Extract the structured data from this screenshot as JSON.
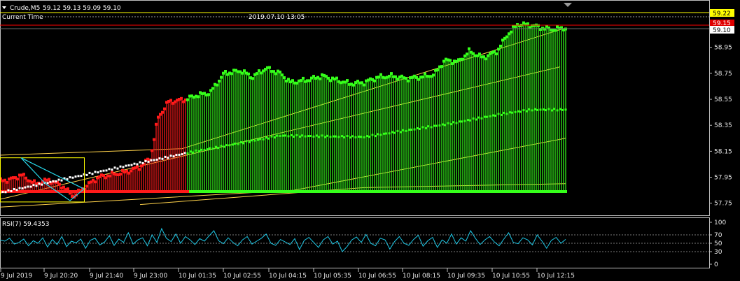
{
  "header": {
    "symbol": "Crude,M5",
    "ohlc": "59.12 59.13 59.09 59.10",
    "current_time_label": "Current Time",
    "current_time_value": "2019.07.10 13:05"
  },
  "price_markers": {
    "high_line": "59.22",
    "red_line": "59.15",
    "current": "59.10"
  },
  "colors": {
    "background": "#000000",
    "bull": "#35ff1a",
    "bear": "#ff1a1a",
    "rsi_line": "#1ec8e6",
    "level_line": "#ffff00",
    "channel_line": "#ffd24a",
    "pattern_line": "#27d6e8",
    "red_marker": "#ff0000",
    "current_marker": "#ffffff"
  },
  "chart_data": [
    {
      "type": "candlestick",
      "title": "Crude,M5",
      "y_ticks": [
        "59.10",
        "58.95",
        "58.75",
        "58.55",
        "58.35",
        "58.15",
        "57.95",
        "57.75"
      ],
      "ylim": [
        57.7,
        59.25
      ],
      "x_ticks": [
        "9 Jul 2019",
        "9 Jul 20:20",
        "9 Jul 21:40",
        "9 Jul 23:00",
        "10 Jul 01:35",
        "10 Jul 02:55",
        "10 Jul 04:15",
        "10 Jul 05:35",
        "10 Jul 06:55",
        "10 Jul 08:15",
        "10 Jul 09:35",
        "10 Jul 10:55",
        "10 Jul 12:15"
      ],
      "close_profile": [
        [
          0,
          57.92
        ],
        [
          20,
          57.94
        ],
        [
          30,
          57.97
        ],
        [
          50,
          57.9
        ],
        [
          70,
          57.93
        ],
        [
          90,
          57.88
        ],
        [
          105,
          57.8
        ],
        [
          118,
          57.86
        ],
        [
          140,
          57.95
        ],
        [
          160,
          57.97
        ],
        [
          180,
          57.99
        ],
        [
          200,
          58.03
        ],
        [
          215,
          58.1
        ],
        [
          225,
          58.4
        ],
        [
          240,
          58.53
        ],
        [
          266,
          58.55
        ],
        [
          280,
          58.58
        ],
        [
          300,
          58.6
        ],
        [
          320,
          58.75
        ],
        [
          345,
          58.77
        ],
        [
          360,
          58.72
        ],
        [
          380,
          58.79
        ],
        [
          400,
          58.75
        ],
        [
          415,
          58.68
        ],
        [
          440,
          58.7
        ],
        [
          460,
          58.73
        ],
        [
          480,
          58.7
        ],
        [
          500,
          58.67
        ],
        [
          520,
          58.68
        ],
        [
          540,
          58.72
        ],
        [
          560,
          58.73
        ],
        [
          580,
          58.71
        ],
        [
          600,
          58.72
        ],
        [
          620,
          58.74
        ],
        [
          635,
          58.85
        ],
        [
          655,
          58.84
        ],
        [
          670,
          58.92
        ],
        [
          690,
          58.87
        ],
        [
          710,
          58.92
        ],
        [
          725,
          59.05
        ],
        [
          740,
          59.13
        ],
        [
          760,
          59.12
        ],
        [
          775,
          59.1
        ],
        [
          790,
          59.09
        ],
        [
          808,
          59.1
        ]
      ],
      "bear_until_x": 268,
      "channel": {
        "upper": [
          [
            0,
            58.12
          ],
          [
            260,
            58.17
          ],
          [
            808,
            59.1
          ]
        ],
        "middle": [
          [
            0,
            57.78
          ],
          [
            800,
            58.8
          ]
        ],
        "lower": [
          [
            0,
            57.72
          ],
          [
            420,
            57.85
          ],
          [
            808,
            58.25
          ]
        ],
        "bottom": [
          [
            200,
            57.74
          ],
          [
            520,
            57.87
          ],
          [
            808,
            57.9
          ]
        ]
      },
      "trend_points": [
        [
          0,
          57.83
        ],
        [
          270,
          58.14
        ],
        [
          400,
          58.27
        ],
        [
          520,
          58.26
        ],
        [
          640,
          58.36
        ],
        [
          720,
          58.44
        ],
        [
          760,
          58.47
        ],
        [
          808,
          58.47
        ]
      ],
      "box": {
        "x0": 0,
        "x1": 120,
        "top": 58.1,
        "bottom": 57.76
      }
    },
    {
      "type": "line",
      "title": "RSI(7) 59.4353",
      "ylim": [
        0,
        100
      ],
      "y_ticks": [
        "100",
        "70",
        "50",
        "30",
        "0"
      ],
      "levels": [
        70,
        50,
        30
      ],
      "values": [
        58,
        55,
        62,
        48,
        52,
        60,
        44,
        56,
        50,
        63,
        41,
        59,
        47,
        66,
        42,
        55,
        51,
        60,
        38,
        57,
        62,
        46,
        53,
        68,
        45,
        60,
        52,
        75,
        48,
        58,
        63,
        44,
        70,
        52,
        85,
        62,
        54,
        72,
        50,
        66,
        58,
        47,
        61,
        55,
        68,
        80,
        56,
        49,
        63,
        52,
        44,
        58,
        66,
        48,
        55,
        62,
        72,
        50,
        45,
        59,
        53,
        47,
        61,
        35,
        57,
        64,
        52,
        40,
        58,
        66,
        48,
        55,
        30,
        42,
        58,
        65,
        52,
        71,
        50,
        44,
        62,
        58,
        36,
        54,
        66,
        50,
        45,
        59,
        69,
        43,
        56,
        64,
        40,
        58,
        50,
        72,
        48,
        63,
        55,
        80,
        62,
        47,
        58,
        66,
        53,
        44,
        60,
        75,
        52,
        49,
        63,
        58,
        46,
        70,
        55,
        38,
        57,
        64,
        50,
        59.4
      ]
    }
  ]
}
